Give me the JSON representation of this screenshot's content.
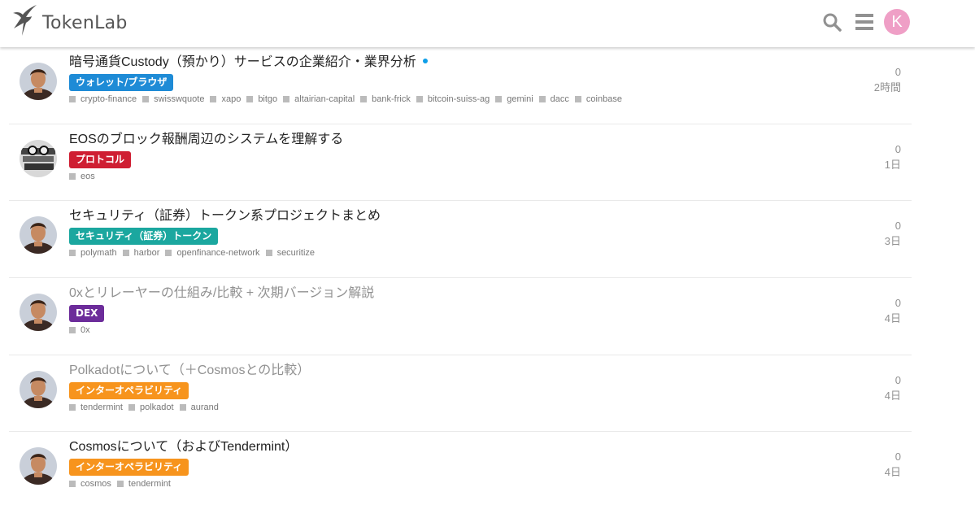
{
  "site": {
    "name": "TokenLab"
  },
  "header": {
    "avatar_letter": "K",
    "avatar_color": "#ef9fc6"
  },
  "topics": [
    {
      "title": "暗号通貨Custody（預かり）サービスの企業紹介・業界分析",
      "unread": true,
      "visited": false,
      "avatar": "author-photo",
      "category": {
        "label": "ウォレット/ブラウザ",
        "color": "#1e8bd6"
      },
      "tags": [
        "crypto-finance",
        "swisswquote",
        "xapo",
        "bitgo",
        "altairian-capital",
        "bank-frick",
        "bitcoin-suiss-ag",
        "gemini",
        "dacc",
        "coinbase"
      ],
      "replies": "0",
      "age": "2時間"
    },
    {
      "title": "EOSのブロック報酬周辺のシステムを理解する",
      "unread": false,
      "visited": false,
      "avatar": "author-bw-photo",
      "category": {
        "label": "プロトコル",
        "color": "#cf1e32"
      },
      "tags": [
        "eos"
      ],
      "replies": "0",
      "age": "1日"
    },
    {
      "title": "セキュリティ（証券）トークン系プロジェクトまとめ",
      "unread": false,
      "visited": false,
      "avatar": "author-photo",
      "category": {
        "label": "セキュリティ（証券）トークン",
        "color": "#1ba79f"
      },
      "tags": [
        "polymath",
        "harbor",
        "openfinance-network",
        "securitize"
      ],
      "replies": "0",
      "age": "3日"
    },
    {
      "title": "0xとリレーヤーの仕組み/比較 + 次期バージョン解説",
      "unread": false,
      "visited": true,
      "avatar": "author-photo",
      "category": {
        "label": "DEX",
        "color": "#6c2c9a"
      },
      "tags": [
        "0x"
      ],
      "replies": "0",
      "age": "4日"
    },
    {
      "title": "Polkadotについて（＋Cosmosとの比較）",
      "unread": false,
      "visited": true,
      "avatar": "author-photo",
      "category": {
        "label": "インターオペラビリティ",
        "color": "#f7941d"
      },
      "tags": [
        "tendermint",
        "polkadot",
        "aurand"
      ],
      "replies": "0",
      "age": "4日"
    },
    {
      "title": "Cosmosについて（およびTendermint）",
      "unread": false,
      "visited": false,
      "avatar": "author-photo",
      "category": {
        "label": "インターオペラビリティ",
        "color": "#f7941d"
      },
      "tags": [
        "cosmos",
        "tendermint"
      ],
      "replies": "0",
      "age": "4日"
    }
  ]
}
